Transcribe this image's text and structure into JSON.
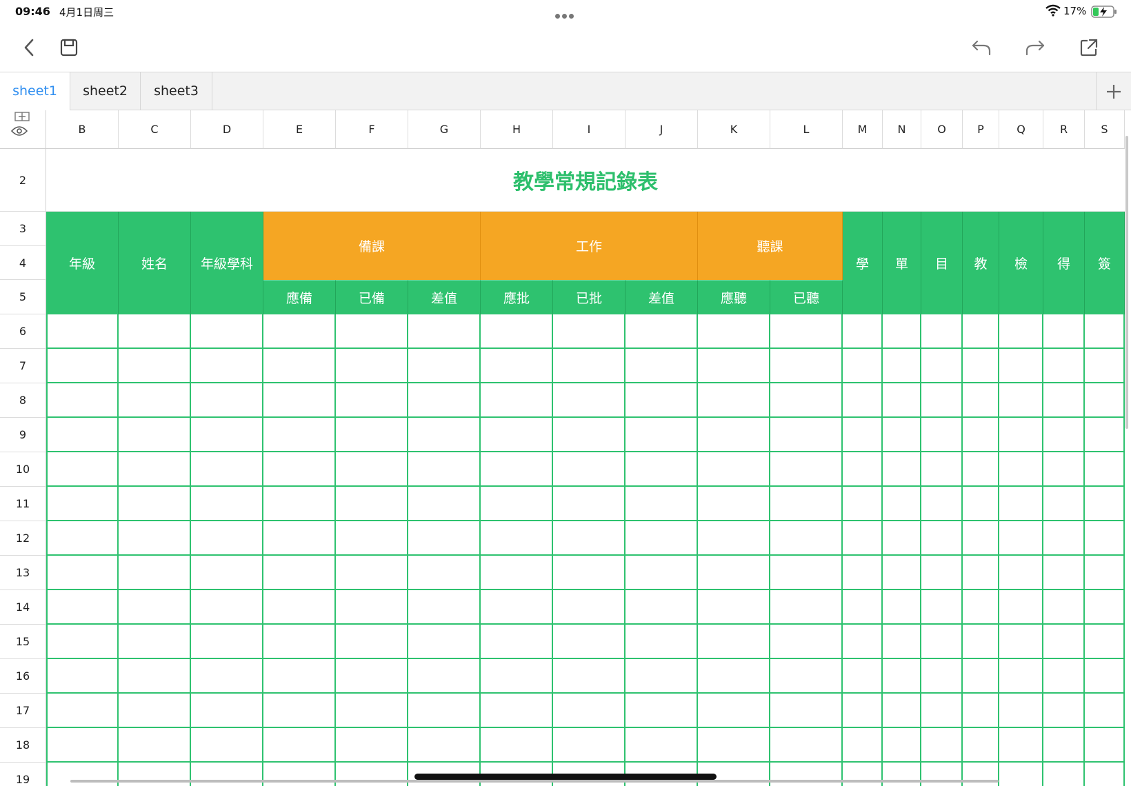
{
  "status": {
    "time": "09:46",
    "date": "4月1日周三",
    "battery": "17%"
  },
  "toolbar": {
    "icons": [
      "back-icon",
      "save-icon",
      "undo-icon",
      "redo-icon",
      "share-icon"
    ]
  },
  "tabs": [
    {
      "label": "sheet1",
      "active": true
    },
    {
      "label": "sheet2",
      "active": false
    },
    {
      "label": "sheet3",
      "active": false
    }
  ],
  "columns": [
    "B",
    "C",
    "D",
    "E",
    "F",
    "G",
    "H",
    "I",
    "J",
    "K",
    "L",
    "M",
    "N",
    "O",
    "P",
    "Q",
    "R",
    "S"
  ],
  "rows": [
    "2",
    "3",
    "4",
    "5",
    "6",
    "7",
    "8",
    "9",
    "10",
    "11",
    "12",
    "13",
    "14",
    "15",
    "16",
    "17",
    "18",
    "19"
  ],
  "sheet": {
    "title": "教學常規記錄表",
    "header": {
      "grade": "年級",
      "name": "姓名",
      "grade_subject": "年級學科",
      "prep": "備課",
      "work": "工作",
      "listen": "聽課",
      "prep_due": "應備",
      "prep_done": "已備",
      "prep_diff": "差值",
      "work_due": "應批",
      "work_done": "已批",
      "work_diff": "差值",
      "listen_due": "應聽",
      "listen_done": "已聽",
      "m": "學",
      "n": "單",
      "o": "目",
      "p": "教",
      "q": "檢",
      "r": "得",
      "s": "簽"
    }
  },
  "colors": {
    "accent_blue": "#2f8ef0",
    "header_green": "#2ec26f",
    "header_orange": "#f5a623",
    "title_green": "#2dbf6c"
  }
}
